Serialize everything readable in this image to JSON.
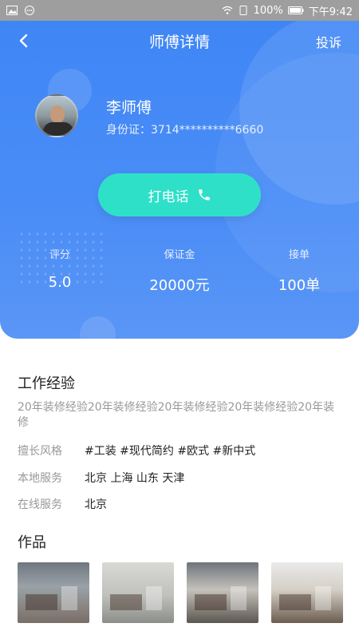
{
  "status_bar": {
    "battery": "100%",
    "time": "下午9:42"
  },
  "header": {
    "title": "师傅详情",
    "complain_label": "投诉"
  },
  "profile": {
    "name": "李师傅",
    "id_card": "身份证：3714**********6660"
  },
  "call_button": {
    "label": "打电话"
  },
  "stats": [
    {
      "label": "评分",
      "value": "5.0"
    },
    {
      "label": "保证金",
      "value": "20000元"
    },
    {
      "label": "接单",
      "value": "100单"
    }
  ],
  "experience": {
    "title": "工作经验",
    "text": "20年装修经验20年装修经验20年装修经验20年装修经验20年装修",
    "rows": [
      {
        "key": "擅长风格",
        "value": "#工装 #现代简约 #欧式 #新中式"
      },
      {
        "key": "本地服务",
        "value": "北京 上海 山东 天津"
      },
      {
        "key": "在线服务",
        "value": "北京"
      }
    ]
  },
  "works": {
    "title": "作品"
  },
  "colors": {
    "primary": "#4a8df7",
    "call_button": "#2fe0c9"
  }
}
